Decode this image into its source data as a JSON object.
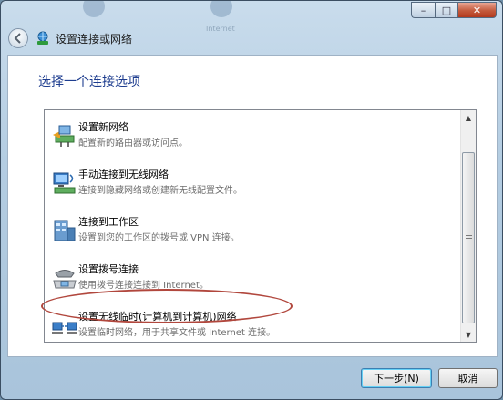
{
  "window": {
    "title": "设置连接或网络",
    "background_blur_text": "Internet"
  },
  "caption": {
    "min": "–",
    "max": "□",
    "close": "✕"
  },
  "page": {
    "heading": "选择一个连接选项"
  },
  "options": [
    {
      "title": "设置新网络",
      "description": "配置新的路由器或访问点。",
      "icon": "new-network-icon"
    },
    {
      "title": "手动连接到无线网络",
      "description": "连接到隐藏网络或创建新无线配置文件。",
      "icon": "wireless-network-icon"
    },
    {
      "title": "连接到工作区",
      "description": "设置到您的工作区的拨号或 VPN 连接。",
      "icon": "workplace-icon"
    },
    {
      "title": "设置拨号连接",
      "description": "使用拨号连接连接到 Internet。",
      "icon": "dialup-phone-icon"
    },
    {
      "title": "设置无线临时(计算机到计算机)网络",
      "description": "设置临时网络，用于共享文件或 Internet 连接。",
      "icon": "adhoc-network-icon"
    }
  ],
  "buttons": {
    "next": "下一步(N)",
    "cancel": "取消"
  },
  "colors": {
    "heading": "#1e3d8f",
    "annotation": "#b1473d"
  }
}
